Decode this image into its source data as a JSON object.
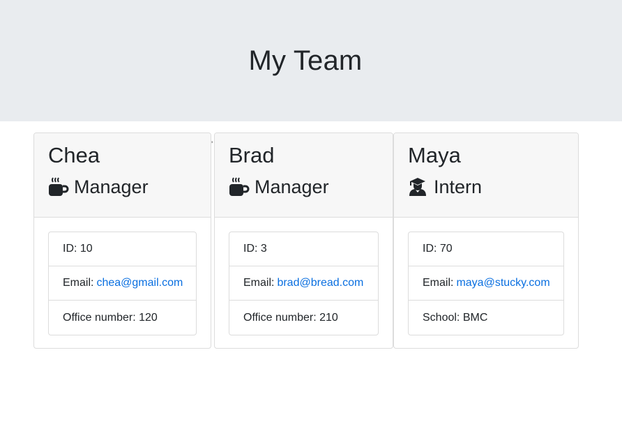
{
  "header": {
    "title": "My Team"
  },
  "employees": [
    {
      "name": "Chea",
      "role": "Manager",
      "role_icon": "coffee-mug-icon",
      "id_text": "ID: 10",
      "email_label": "Email:",
      "email": "chea@gmail.com",
      "extra_text": "Office number: 120"
    },
    {
      "name": "Brad",
      "role": "Manager",
      "role_icon": "coffee-mug-icon",
      "id_text": "ID: 3",
      "email_label": "Email:",
      "email": "brad@bread.com",
      "extra_text": "Office number: 210"
    },
    {
      "name": "Maya",
      "role": "Intern",
      "role_icon": "graduate-icon",
      "id_text": "ID: 70",
      "email_label": "Email:",
      "email": "maya@stucky.com",
      "extra_text": "School: BMC"
    }
  ],
  "stray_mark": "'",
  "colors": {
    "header_bg": "#e9ecef",
    "link": "#0a6fe0",
    "card_header_bg": "#f7f7f7"
  }
}
